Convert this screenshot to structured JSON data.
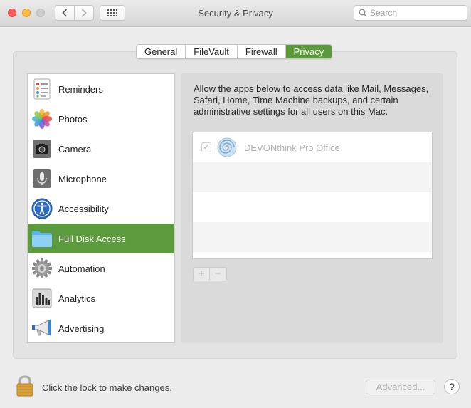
{
  "window": {
    "title": "Security & Privacy",
    "search_placeholder": "Search"
  },
  "tabs": [
    {
      "label": "General"
    },
    {
      "label": "FileVault"
    },
    {
      "label": "Firewall"
    },
    {
      "label": "Privacy",
      "active": true
    }
  ],
  "sidebar": {
    "items": [
      {
        "label": "Reminders",
        "icon": "reminders-icon"
      },
      {
        "label": "Photos",
        "icon": "photos-icon"
      },
      {
        "label": "Camera",
        "icon": "camera-icon"
      },
      {
        "label": "Microphone",
        "icon": "microphone-icon"
      },
      {
        "label": "Accessibility",
        "icon": "accessibility-icon"
      },
      {
        "label": "Full Disk Access",
        "icon": "folder-icon",
        "selected": true
      },
      {
        "label": "Automation",
        "icon": "gear-icon"
      },
      {
        "label": "Analytics",
        "icon": "analytics-icon"
      },
      {
        "label": "Advertising",
        "icon": "megaphone-icon"
      }
    ]
  },
  "panel": {
    "description": "Allow the apps below to access data like Mail, Messages, Safari, Home, Time Machine backups, and certain administrative settings for all users on this Mac.",
    "apps": [
      {
        "name": "DEVONthink Pro Office",
        "checked": true,
        "icon": "devonthink-icon"
      }
    ],
    "add_label": "+",
    "remove_label": "−"
  },
  "footer": {
    "lock_text": "Click the lock to make changes.",
    "advanced_label": "Advanced...",
    "help_label": "?"
  },
  "colors": {
    "accent": "#5b9a3d"
  }
}
